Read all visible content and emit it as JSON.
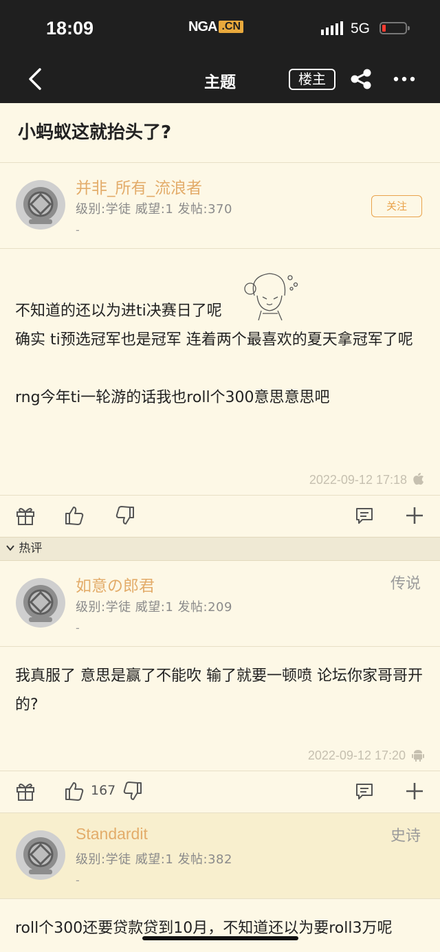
{
  "status": {
    "time": "18:09",
    "network": "5G",
    "logo_main": "NGA",
    "logo_suffix": ".CN"
  },
  "nav": {
    "title": "主题",
    "op_button": "楼主"
  },
  "topic": {
    "title": "小蚂蚁这就抬头了?"
  },
  "posts": [
    {
      "username": "并非_所有_流浪者",
      "meta": "级别:学徒  威望:1  发帖:370",
      "dash": "-",
      "follow_label": "关注",
      "content": [
        "不知道的还以为进ti决赛日了呢",
        "确实 ti预选冠军也是冠军 连着两个最喜欢的夏天拿冠军了呢",
        "",
        "rng今年ti一轮游的话我也roll个300意思意思吧"
      ],
      "date": "2022-09-12 17:18",
      "device": "apple-icon"
    },
    {
      "username": "如意の郎君",
      "meta": "级别:学徒  威望:1  发帖:209",
      "dash": "-",
      "rank": "传说",
      "content": [
        "我真服了 意思是赢了不能吹 输了就要一顿喷 论坛你家哥哥开的?"
      ],
      "date": "2022-09-12 17:20",
      "device": "android-icon",
      "likes": "167"
    },
    {
      "username": "Standardit",
      "meta": "级别:学徒  威望:1  发帖:382",
      "dash": "-",
      "rank": "史诗",
      "content": [
        "roll个300还要贷款贷到10月，不知道还以为要roll3万呢"
      ]
    }
  ],
  "hot_section": {
    "label": "热评"
  }
}
